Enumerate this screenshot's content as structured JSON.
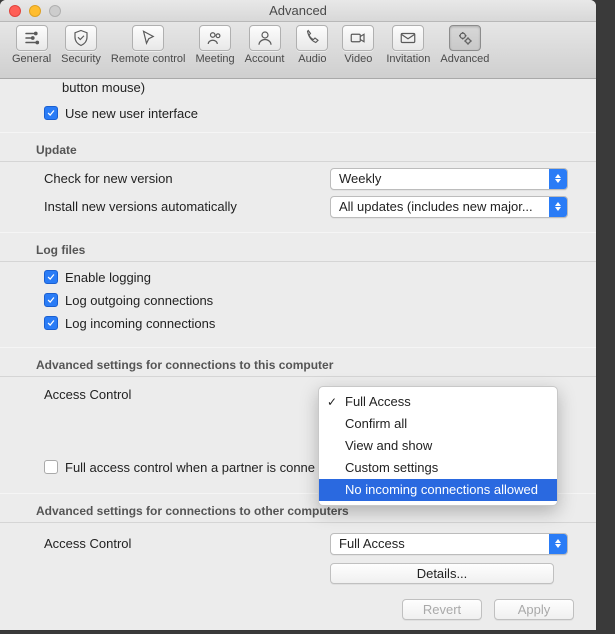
{
  "window": {
    "title": "Advanced"
  },
  "toolbar": {
    "items": [
      {
        "label": "General"
      },
      {
        "label": "Security"
      },
      {
        "label": "Remote control"
      },
      {
        "label": "Meeting"
      },
      {
        "label": "Account"
      },
      {
        "label": "Audio"
      },
      {
        "label": "Video"
      },
      {
        "label": "Invitation"
      },
      {
        "label": "Advanced"
      }
    ]
  },
  "partial_top": {
    "fragment_line": "button mouse)",
    "use_new_ui": "Use new user interface"
  },
  "sections": {
    "update": {
      "title": "Update",
      "check_label": "Check for new version",
      "check_value": "Weekly",
      "install_label": "Install new versions automatically",
      "install_value": "All updates (includes new major..."
    },
    "log": {
      "title": "Log files",
      "enable": "Enable logging",
      "outgoing": "Log outgoing connections",
      "incoming": "Log incoming connections"
    },
    "adv_this": {
      "title": "Advanced settings for connections to this computer",
      "access_label": "Access Control",
      "full_access_partner": "Full access control when a partner is conne",
      "menu": {
        "items": [
          "Full Access",
          "Confirm all",
          "View and show",
          "Custom settings",
          "No incoming connections allowed"
        ],
        "checked_index": 0,
        "highlight_index": 4
      }
    },
    "adv_other": {
      "title": "Advanced settings for connections to other computers",
      "access_label": "Access Control",
      "access_value": "Full Access",
      "details": "Details..."
    }
  },
  "footer": {
    "revert": "Revert",
    "apply": "Apply"
  }
}
